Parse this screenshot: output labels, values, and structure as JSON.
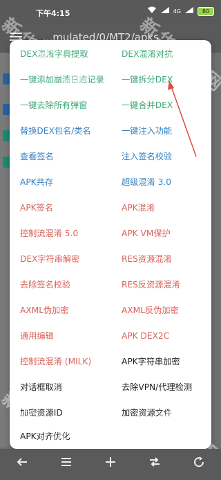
{
  "status_bar": {
    "time": "下午4:15",
    "signal_text": "4G",
    "battery": "80"
  },
  "toolbar": {
    "path": "...mulated/0/MT2/apks"
  },
  "menu": {
    "items": [
      {
        "label": "DEX混淆字典提取",
        "color": "#3fa878"
      },
      {
        "label": "DEX混淆对抗",
        "color": "#3fa878"
      },
      {
        "label": "一键添加崩溃日志记录",
        "color": "#3fa878"
      },
      {
        "label": "一键拆分DEX",
        "color": "#3fa878"
      },
      {
        "label": "一键去除所有弹窗",
        "color": "#3fa878"
      },
      {
        "label": "一键合并DEX",
        "color": "#3fa878"
      },
      {
        "label": "替换DEX包名/类名",
        "color": "#3483c7"
      },
      {
        "label": "一键注入功能",
        "color": "#3483c7"
      },
      {
        "label": "查看签名",
        "color": "#3483c7"
      },
      {
        "label": "注入签名校验",
        "color": "#3483c7"
      },
      {
        "label": "APK共存",
        "color": "#3483c7"
      },
      {
        "label": "超级混淆 3.0",
        "color": "#3483c7"
      },
      {
        "label": "APK签名",
        "color": "#d9625a"
      },
      {
        "label": "APK混淆",
        "color": "#d9625a"
      },
      {
        "label": "控制流混淆 5.0",
        "color": "#d9625a"
      },
      {
        "label": "APK VM保护",
        "color": "#d9625a"
      },
      {
        "label": "DEX字符串解密",
        "color": "#d9625a"
      },
      {
        "label": "RES资源混淆",
        "color": "#d9625a"
      },
      {
        "label": "去除签名校验",
        "color": "#d9625a"
      },
      {
        "label": "RES反资源混淆",
        "color": "#d9625a"
      },
      {
        "label": "AXML伪加密",
        "color": "#d9625a"
      },
      {
        "label": "AXML反伪加密",
        "color": "#d9625a"
      },
      {
        "label": "通用编辑",
        "color": "#d9625a"
      },
      {
        "label": "APK DEX2C",
        "color": "#d9625a"
      },
      {
        "label": "控制流混淆 (MILK)",
        "color": "#d9625a"
      },
      {
        "label": "APK字符串加密",
        "color": "#222222"
      },
      {
        "label": "对话框取消",
        "color": "#222222"
      },
      {
        "label": "去除VPN/代理检测",
        "color": "#222222"
      },
      {
        "label": "加密资源ID",
        "color": "#222222"
      },
      {
        "label": "加密资源文件",
        "color": "#222222"
      },
      {
        "label": "APK对齐优化",
        "color": "#222222"
      }
    ]
  },
  "bottom_bar": {
    "icons": [
      "back-arrow-icon",
      "sort-lines-icon",
      "add-icon",
      "swap-icon",
      "refresh-icon"
    ]
  },
  "watermark": {
    "text": "新华手游网"
  }
}
